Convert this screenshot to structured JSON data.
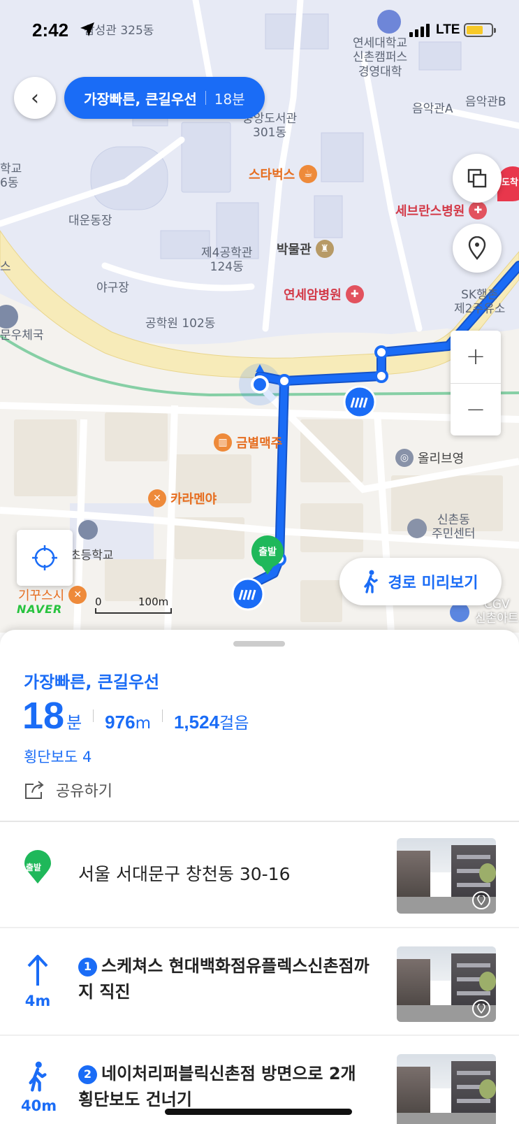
{
  "status_bar": {
    "time": "2:42",
    "network": "LTE",
    "battery_percent": 68
  },
  "top_bar": {
    "back_label": "‹",
    "route_name": "가장빠른, 큰길우선",
    "route_minutes": "18분"
  },
  "map": {
    "labels": {
      "samsung": "삼성관 325동",
      "yonsei": "연세대학교\n신촌캠퍼스\n경영대학",
      "music_a": "음악관A",
      "music_b": "음악관B",
      "library": "중앙도서관\n301동",
      "school_left": "학교\n6동",
      "daeun": "대운동장",
      "eng4": "제4공학관\n124동",
      "baseball": "야구장",
      "eng_hall": "공학원 102동",
      "post": "문우체국",
      "sk": "SK행촌\n제2주유소",
      "dest_tag": "도착",
      "elementary": "초등학교",
      "community": "신촌동\n주민센터",
      "cgv": "CGV\n신촌아트",
      "s_left": "스"
    },
    "pois": {
      "starbucks": "스타벅스",
      "severance": "세브란스병원",
      "museum": "박물관",
      "cancer": "연세암병원",
      "geumbyeol": "금별맥주",
      "oliveyoung": "올리브영",
      "karamenya": "카라멘야",
      "gikkusushi": "기꾸스시"
    },
    "start_marker": "출발",
    "scale_zero": "0",
    "scale_label": "100m",
    "brand": "NAVER",
    "route_color": "#1a6cf6"
  },
  "buttons": {
    "zoom_in": "+",
    "zoom_out": "−",
    "preview": "경로 미리보기"
  },
  "summary": {
    "title": "가장빠른, 큰길우선",
    "minutes": "18",
    "minutes_unit": "분",
    "distance": "976",
    "distance_unit": "m",
    "steps_count": "1,524",
    "steps_unit": "걸음",
    "crosswalks": "횡단보도 4",
    "share": "공유하기"
  },
  "steps": [
    {
      "badge": "출발",
      "text": "서울 서대문구 창천동 30-16"
    },
    {
      "number": "1",
      "distance": "4m",
      "text": "스케쳐스 현대백화점유플렉스신촌점까지 직진"
    },
    {
      "number": "2",
      "distance": "40m",
      "text": "네이처리퍼블릭신촌점 방면으로 2개 횡단보도 건너기"
    }
  ]
}
